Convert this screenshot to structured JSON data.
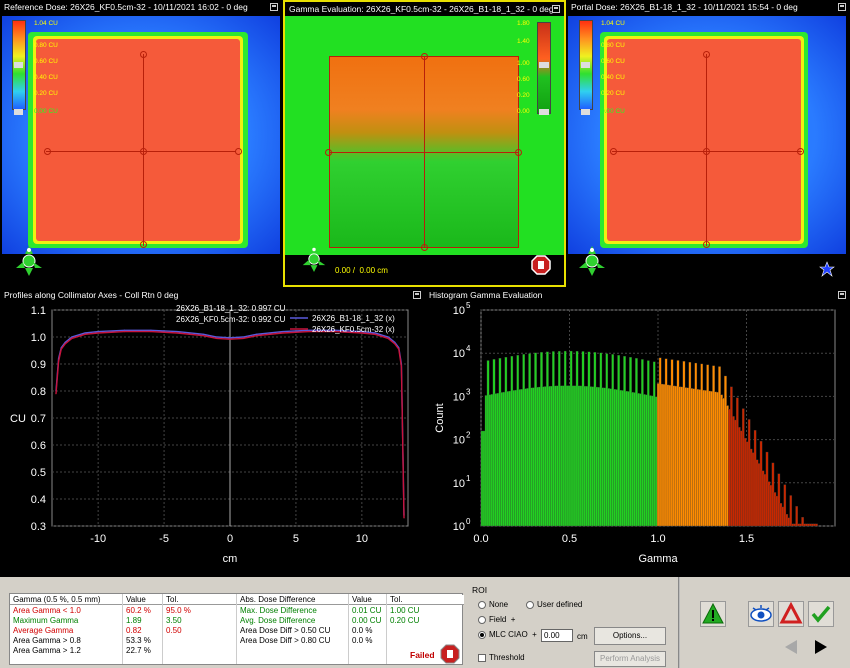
{
  "panels": {
    "reference": {
      "title": "Reference Dose: 26X26_KF0.5cm-32 - 10/11/2021 16:02 - 0 deg",
      "labels": [
        "1.04 CU",
        "0.80 CU",
        "0.60 CU",
        "0.40 CU",
        "0.20 CU",
        "0.00 CU"
      ]
    },
    "gamma": {
      "title": "Gamma Evaluation: 26X26_KF0.5cm-32 - 26X26_B1-18_1_32 - 0 deg",
      "labels": [
        "1.80",
        "1.40",
        "1.00",
        "0.60",
        "0.20",
        "0.00"
      ],
      "coords": "0.00 /  0.00 cm"
    },
    "portal": {
      "title": "Portal Dose: 26X26_B1-18_1_32 - 10/11/2021 15:54 - 0 deg",
      "labels": [
        "1.04 CU",
        "0.80 CU",
        "0.60 CU",
        "0.40 CU",
        "0.20 CU",
        "0.00 CU"
      ]
    }
  },
  "profiles": {
    "title": "Profiles along Collimator Axes - Coll Rtn 0 deg",
    "readout1": "26X26_B1-18_1_32: 0.997 CU",
    "readout2": "26X26_KF0.5cm-32: 0.992 CU"
  },
  "histogram": {
    "title": "Histogram Gamma Evaluation"
  },
  "chart_data": [
    {
      "type": "line",
      "xlabel": "cm",
      "ylabel": "CU",
      "xlim": [
        -13.5,
        13.5
      ],
      "ylim": [
        0.3,
        1.1
      ],
      "x_ticks": [
        "-10",
        "-5",
        "0",
        "5",
        "10"
      ],
      "y_ticks": [
        "0.3",
        "0.4",
        "0.5",
        "0.6",
        "0.7",
        "0.8",
        "0.9",
        "1.0",
        "1.1"
      ],
      "series": [
        {
          "name": "26X26_B1-18_1_32 (x)",
          "color": "#5a5adc",
          "x": [
            -13.2,
            -13.0,
            -12.8,
            -12.5,
            -12,
            -11,
            -10,
            -8,
            -6,
            -4,
            -2,
            -1,
            0,
            1,
            2,
            4,
            6,
            8,
            10,
            11,
            12,
            12.5,
            12.8,
            13.0,
            13.2
          ],
          "y": [
            0.8,
            0.92,
            0.96,
            0.98,
            1.0,
            1.015,
            1.02,
            1.025,
            1.025,
            1.02,
            1.01,
            1.0,
            0.997,
            1.0,
            1.01,
            1.02,
            1.025,
            1.025,
            1.02,
            1.015,
            1.0,
            0.98,
            0.96,
            0.9,
            0.34
          ]
        },
        {
          "name": "26X26_KF0.5cm-32 (x)",
          "color": "#c8143c",
          "x": [
            -13.2,
            -13.0,
            -12.8,
            -12.5,
            -12,
            -11,
            -10,
            -8,
            -6,
            -4,
            -2,
            -1,
            0,
            1,
            2,
            4,
            6,
            8,
            10,
            11,
            12,
            12.5,
            12.8,
            13.0,
            13.2
          ],
          "y": [
            0.79,
            0.91,
            0.955,
            0.975,
            0.995,
            1.01,
            1.015,
            1.02,
            1.02,
            1.015,
            1.005,
            0.995,
            0.992,
            0.995,
            1.005,
            1.015,
            1.02,
            1.02,
            1.015,
            1.01,
            0.995,
            0.975,
            0.955,
            0.89,
            0.33
          ]
        }
      ]
    },
    {
      "type": "bar",
      "xlabel": "Gamma",
      "ylabel": "Count",
      "xlim": [
        0.0,
        2.0
      ],
      "ylim_log10": [
        0,
        5
      ],
      "x_ticks": [
        "0.0",
        "0.5",
        "1.0",
        "1.5"
      ],
      "y_ticks_exp": [
        "0",
        "1",
        "2",
        "3",
        "4",
        "5"
      ],
      "threshold": 1.0,
      "colors": {
        "pass": "#22d022",
        "fail_start": "#ff8c00",
        "fail_end": "#c82800"
      }
    }
  ],
  "results": {
    "header": [
      "Gamma (0.5 %, 0.5 mm)",
      "Value",
      "Tol.",
      "Abs. Dose Difference",
      "Value",
      "Tol."
    ],
    "left_rows": [
      {
        "label": "Area Gamma < 1.0",
        "value": "60.2 %",
        "tol": "95.0 %",
        "color": "#d00000"
      },
      {
        "label": "Maximum Gamma",
        "value": "1.89",
        "tol": "3.50",
        "color": "#008000"
      },
      {
        "label": "Average Gamma",
        "value": "0.82",
        "tol": "0.50",
        "color": "#d00000"
      },
      {
        "label": "Area Gamma > 0.8",
        "value": "53.3 %",
        "tol": "",
        "color": "#000000"
      },
      {
        "label": "Area Gamma > 1.2",
        "value": "22.7 %",
        "tol": "",
        "color": "#000000"
      }
    ],
    "right_rows": [
      {
        "label": "Max. Dose Difference",
        "value": "0.01 CU",
        "tol": "1.00 CU",
        "color": "#008000"
      },
      {
        "label": "Avg. Dose Difference",
        "value": "0.00 CU",
        "tol": "0.20 CU",
        "color": "#008000"
      },
      {
        "label": "Area Dose Diff > 0.50 CU",
        "value": "0.0 %",
        "tol": "",
        "color": "#000000"
      },
      {
        "label": "Area Dose Diff > 0.80 CU",
        "value": "0.0 %",
        "tol": "",
        "color": "#000000"
      }
    ],
    "status": "Failed"
  },
  "roi": {
    "title": "ROI",
    "none": "None",
    "user": "User defined",
    "field": "Field",
    "mlc": "MLC CIAO",
    "plus": "+",
    "margin": "0.00",
    "unit": "cm",
    "threshold": "Threshold",
    "options": "Options...",
    "perform": "Perform Analysis"
  }
}
